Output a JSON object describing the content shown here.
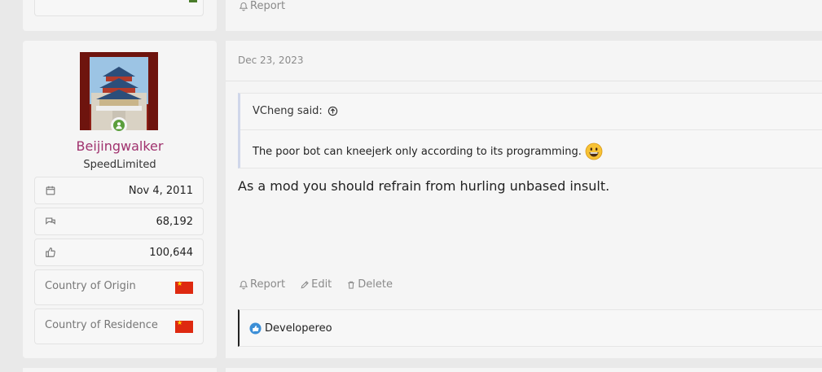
{
  "previous_post": {
    "report_label": "Report"
  },
  "post": {
    "date": "Dec 23, 2023",
    "author": {
      "username": "Beijingwalker",
      "user_title": "SpeedLimited",
      "joined": "Nov 4, 2011",
      "messages": "68,192",
      "reactions": "100,644",
      "country_of_origin_label": "Country of Origin",
      "country_of_residence_label": "Country of Residence",
      "online_status_color": "#5b9e3c"
    },
    "quote": {
      "author_said": "VCheng said:",
      "text": "The poor bot can kneejerk only according to its programming."
    },
    "body": "As a mod you should refrain from hurling unbased insult.",
    "actions": {
      "report": "Report",
      "edit": "Edit",
      "delete": "Delete"
    },
    "reaction_list": {
      "names": "Developereo"
    }
  },
  "colors": {
    "username": "#a0326e",
    "quote_border": "#d0d7ea",
    "like_icon": "#3b8ed6"
  }
}
